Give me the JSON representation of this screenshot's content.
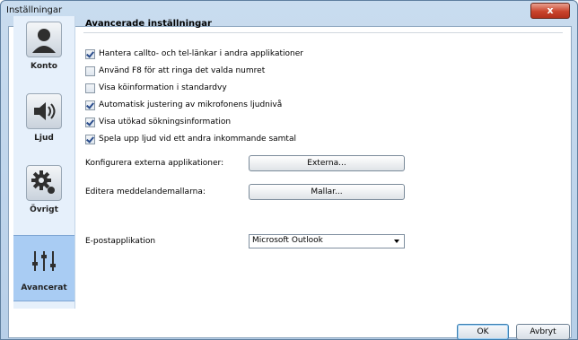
{
  "window": {
    "title": "Inställningar",
    "close_label": "x"
  },
  "sidebar": {
    "items": [
      {
        "label": "Konto",
        "icon": "person-icon",
        "selected": false
      },
      {
        "label": "Ljud",
        "icon": "speaker-icon",
        "selected": false
      },
      {
        "label": "Övrigt",
        "icon": "gear-icon",
        "selected": false
      },
      {
        "label": "Avancerat",
        "icon": "sliders-icon",
        "selected": true
      }
    ]
  },
  "main": {
    "section_title": "Avancerade inställningar",
    "options": [
      {
        "label": "Hantera callto- och tel-länkar i andra applikationer",
        "checked": true
      },
      {
        "label": "Använd F8 för att ringa det valda numret",
        "checked": false
      },
      {
        "label": "Visa köinformation i standardvy",
        "checked": false
      },
      {
        "label": "Automatisk justering av mikrofonens ljudnivå",
        "checked": true
      },
      {
        "label": "Visa utökad sökningsinformation",
        "checked": true
      },
      {
        "label": "Spela upp ljud vid ett andra inkommande samtal",
        "checked": true
      }
    ],
    "external_apps": {
      "label": "Konfigurera externa applikationer:",
      "button": "Externa..."
    },
    "templates": {
      "label": "Editera meddelandemallarna:",
      "button": "Mallar..."
    },
    "email_app": {
      "label": "E-postapplikation",
      "value": "Microsoft Outlook"
    }
  },
  "footer": {
    "ok_label": "OK",
    "cancel_label": "Avbryt"
  }
}
